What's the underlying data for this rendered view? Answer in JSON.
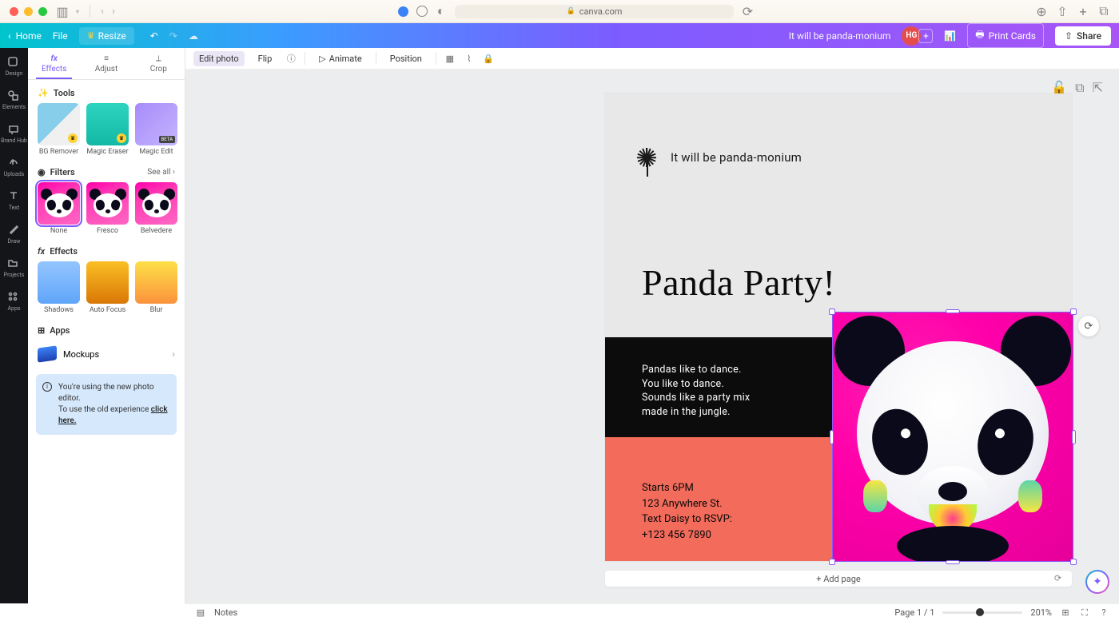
{
  "browser": {
    "url_host": "canva.com"
  },
  "topbar": {
    "home": "Home",
    "file": "File",
    "resize": "Resize",
    "project_name": "It will be panda-monium",
    "avatar_initials": "HG",
    "print": "Print Cards",
    "share": "Share"
  },
  "rail": {
    "design": "Design",
    "elements": "Elements",
    "brand": "Brand Hub",
    "uploads": "Uploads",
    "text": "Text",
    "draw": "Draw",
    "projects": "Projects",
    "apps": "Apps"
  },
  "panel": {
    "tabs": {
      "effects": "Effects",
      "adjust": "Adjust",
      "crop": "Crop"
    },
    "tools": {
      "section": "Tools",
      "items": [
        "BG Remover",
        "Magic Eraser",
        "Magic Edit"
      ]
    },
    "filters": {
      "section": "Filters",
      "see_all": "See all",
      "items": [
        "None",
        "Fresco",
        "Belvedere"
      ]
    },
    "fx": {
      "section": "Effects",
      "items": [
        "Shadows",
        "Auto Focus",
        "Blur"
      ]
    },
    "apps": {
      "section": "Apps",
      "mockups": "Mockups"
    },
    "info": {
      "line1": "You're using the new photo editor.",
      "line2_a": "To use the old experience ",
      "line2_b": "click here."
    }
  },
  "context": {
    "edit_photo": "Edit photo",
    "flip": "Flip",
    "animate": "Animate",
    "position": "Position"
  },
  "design": {
    "tagline": "It will be panda-monium",
    "title": "Panda Party!",
    "poem_line1": "Pandas like to dance.",
    "poem_line2": "You like to dance.",
    "poem_line3": "Sounds like a party mix",
    "poem_line4": "made in the jungle.",
    "details_line1": "Starts 6PM",
    "details_line2": "123 Anywhere St.",
    "details_line3": "Text Daisy to RSVP:",
    "details_line4": "+123 456 7890"
  },
  "add_page": "+ Add page",
  "footer": {
    "notes": "Notes",
    "page_indicator": "Page 1 / 1",
    "zoom": "201%"
  }
}
